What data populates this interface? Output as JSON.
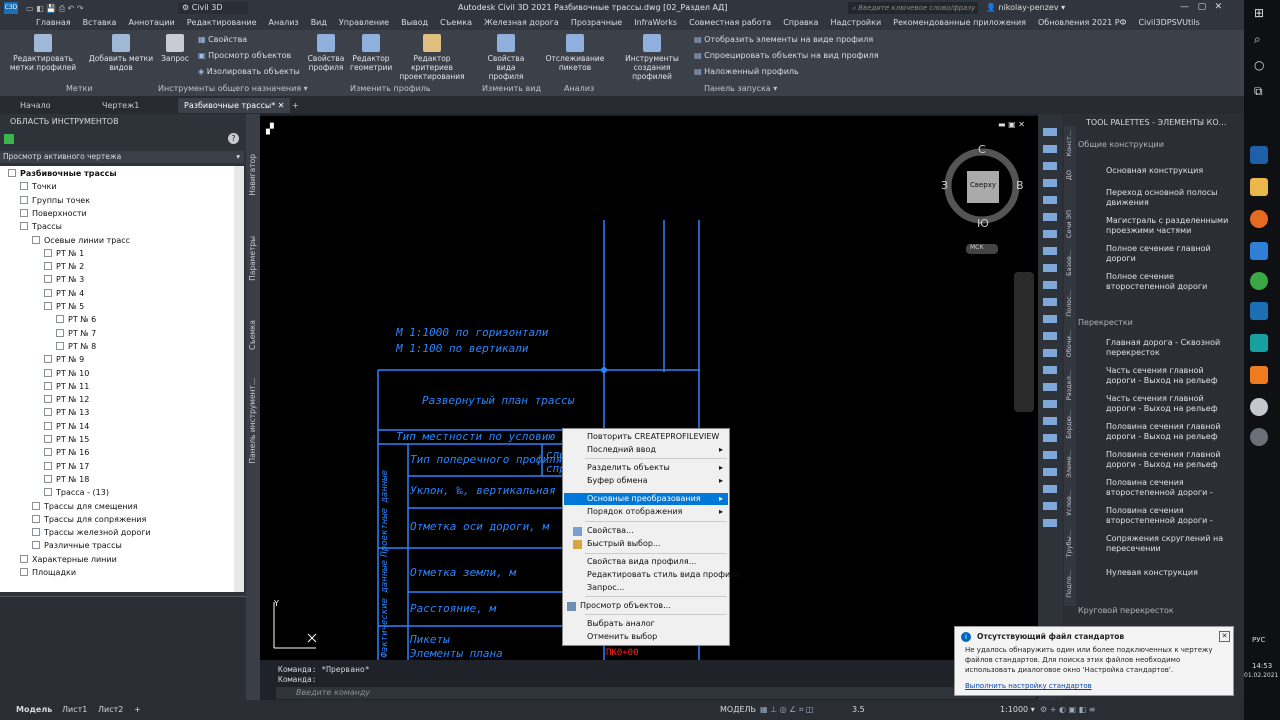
{
  "app": {
    "name": "Civil 3D",
    "title": "Autodesk Civil 3D 2021  Разбивочные трассы.dwg [02_Раздел АД]",
    "search_placeholder": "Введите ключевое слово/фразу",
    "user": "nikolay-penzev"
  },
  "menu": [
    "Главная",
    "Вставка",
    "Аннотации",
    "Редактирование",
    "Анализ",
    "Вид",
    "Управление",
    "Вывод",
    "Съемка",
    "Железная дорога",
    "Прозрачные",
    "InfraWorks",
    "Совместная работа",
    "Справка",
    "Надстройки",
    "Рекомендованные приложения",
    "Обновления 2021 РФ",
    "Civil3DPSVUtils"
  ],
  "ribbon": {
    "buttons": [
      {
        "label": "Редактировать метки профилей"
      },
      {
        "label": "Добавить метки видов"
      },
      {
        "label": "Запрос"
      },
      {
        "label": "Свойства профиля"
      },
      {
        "label": "Редактор геометрии"
      },
      {
        "label": "Редактор критериев проектирования"
      },
      {
        "label": "Свойства вида профиля"
      },
      {
        "label": "Отслеживание пикетов"
      },
      {
        "label": "Инструменты создания профилей"
      }
    ],
    "small": [
      "Свойства",
      "Просмотр объектов",
      "Изолировать объекты",
      "Отобразить элементы на виде профиля",
      "Спроецировать объекты на вид профиля",
      "Наложенный профиль"
    ],
    "groups": [
      "Метки",
      "Инструменты общего назначения",
      "Изменить профиль",
      "Изменить вид",
      "Анализ",
      "Панель запуска"
    ]
  },
  "tabs": [
    "Начало",
    "Чертеж1",
    "Разбивочные трассы*"
  ],
  "toolspace": {
    "title": "ОБЛАСТЬ ИНСТРУМЕНТОВ",
    "view": "Просмотр активного чертежа",
    "tree": [
      "Разбивочные трассы",
      "Точки",
      "Группы точек",
      "Поверхности",
      "Трассы",
      "Осевые линии трасс",
      "РТ № 1",
      "РТ № 2",
      "РТ № 3",
      "РТ № 4",
      "РТ № 5",
      "РТ № 6",
      "РТ № 7",
      "РТ № 8",
      "РТ № 9",
      "РТ № 10",
      "РТ № 11",
      "РТ № 12",
      "РТ № 13",
      "РТ № 14",
      "РТ № 15",
      "РТ № 16",
      "РТ № 17",
      "РТ № 18",
      "Трасса - (13)",
      "Трассы для смещения",
      "Трассы для сопряжения",
      "Трассы железной дороги",
      "Различные трассы",
      "Характерные линии",
      "Площадки"
    ],
    "side_tabs": [
      "Навигатор",
      "Параметры",
      "Съемка",
      "Панель инструмент..."
    ]
  },
  "drawing": {
    "scale1": "М 1:1000 по горизонтали",
    "scale2": "М 1:100 по вертикали",
    "rows": [
      "Развернутый план трассы",
      "Тип местности по условию увлаж",
      "Тип поперечного профиля",
      "Уклон, ‰, вертикальная крив",
      "Отметка оси дороги, м",
      "Отметка земли, м",
      "Расстояние, м",
      "Пикеты",
      "Элементы плана"
    ],
    "vlabel1": "Проектные данные",
    "vlabel2": "Фактические данные",
    "cut1": "сле",
    "cut2": "спр",
    "red": "ПК0+00",
    "viewcube": {
      "top": "Сверху",
      "n": "С",
      "s": "Ю",
      "w": "З",
      "e": "В",
      "ucs": "МСК"
    }
  },
  "context_menu": [
    {
      "label": "Повторить CREATEPROFILEVIEW",
      "sub": false
    },
    {
      "label": "Последний ввод",
      "sub": true
    },
    {
      "label": "Разделить объекты",
      "sub": true
    },
    {
      "label": "Буфер обмена",
      "sub": true
    },
    {
      "label": "Основные преобразования",
      "sub": true,
      "active": true
    },
    {
      "label": "Порядок отображения",
      "sub": true
    },
    {
      "label": "Свойства...",
      "sub": false
    },
    {
      "label": "Быстрый выбор...",
      "sub": false
    },
    {
      "label": "Свойства вида профиля...",
      "sub": false
    },
    {
      "label": "Редактировать стиль вида профиля...",
      "sub": false
    },
    {
      "label": "Запрос...",
      "sub": false
    },
    {
      "label": "Просмотр объектов...",
      "sub": false
    },
    {
      "label": "Выбрать аналог",
      "sub": false
    },
    {
      "label": "Отменить выбор",
      "sub": false
    }
  ],
  "command": {
    "line1": "Команда: *Прервано*",
    "line2": "Команда:",
    "placeholder": "Введите команду"
  },
  "palette": {
    "title": "TOOL PALETTES - ЭЛЕМЕНТЫ КО...",
    "section1": "Общие конструкции",
    "items1": [
      "Основная конструкция",
      "Переход основной полосы движения",
      "Магистраль с разделенными проезжими частями",
      "Полное сечение главной дороги",
      "Полное сечение второстепенной дороги"
    ],
    "section2": "Перекрестки",
    "items2": [
      "Главная дорога - Сквозной перекресток",
      "Часть сечения главной дороги - Выход на рельеф слева",
      "Часть сечения главной дороги - Выход на рельеф справа",
      "Половина сечения главной дороги - Выход на рельеф сл...",
      "Половина сечения главной дороги - Выход на рельеф сп...",
      "Половина сечения второстепенной дороги - Вых...",
      "Половина сечения второстепенной дороги - Вых...",
      "Сопряжения скруглений на пересечении",
      "Нулевая конструкция"
    ],
    "section3": "Круговой перекресток",
    "side_tabs": [
      "Конст...",
      "ДО",
      "Сечи ЭП",
      "Базов...",
      "Полос...",
      "Обочи...",
      "Раздел...",
      "Бордю...",
      "Элеме...",
      "Услов...",
      "Трубы...",
      "Подпо..."
    ]
  },
  "notification": {
    "title": "Отсутствующий файл стандартов",
    "body": "Не удалось обнаружить один или более подключенных к чертежу файлов стандартов. Для поиска этих файлов необходимо использовать диалоговое окно 'Настройка стандартов'.",
    "link": "Выполнить настройку стандартов"
  },
  "status": {
    "tabs": [
      "Модель",
      "Лист1",
      "Лист2"
    ],
    "mode": "МОДЕЛЬ",
    "scale": "1:1000",
    "value": "3.5"
  },
  "tray": {
    "lang": "РУС",
    "time": "14:53",
    "date": "01.02.2021"
  },
  "colors": {
    "cad_blue": "#2b85ff",
    "accent": "#0078d7",
    "red": "#ff2020"
  }
}
